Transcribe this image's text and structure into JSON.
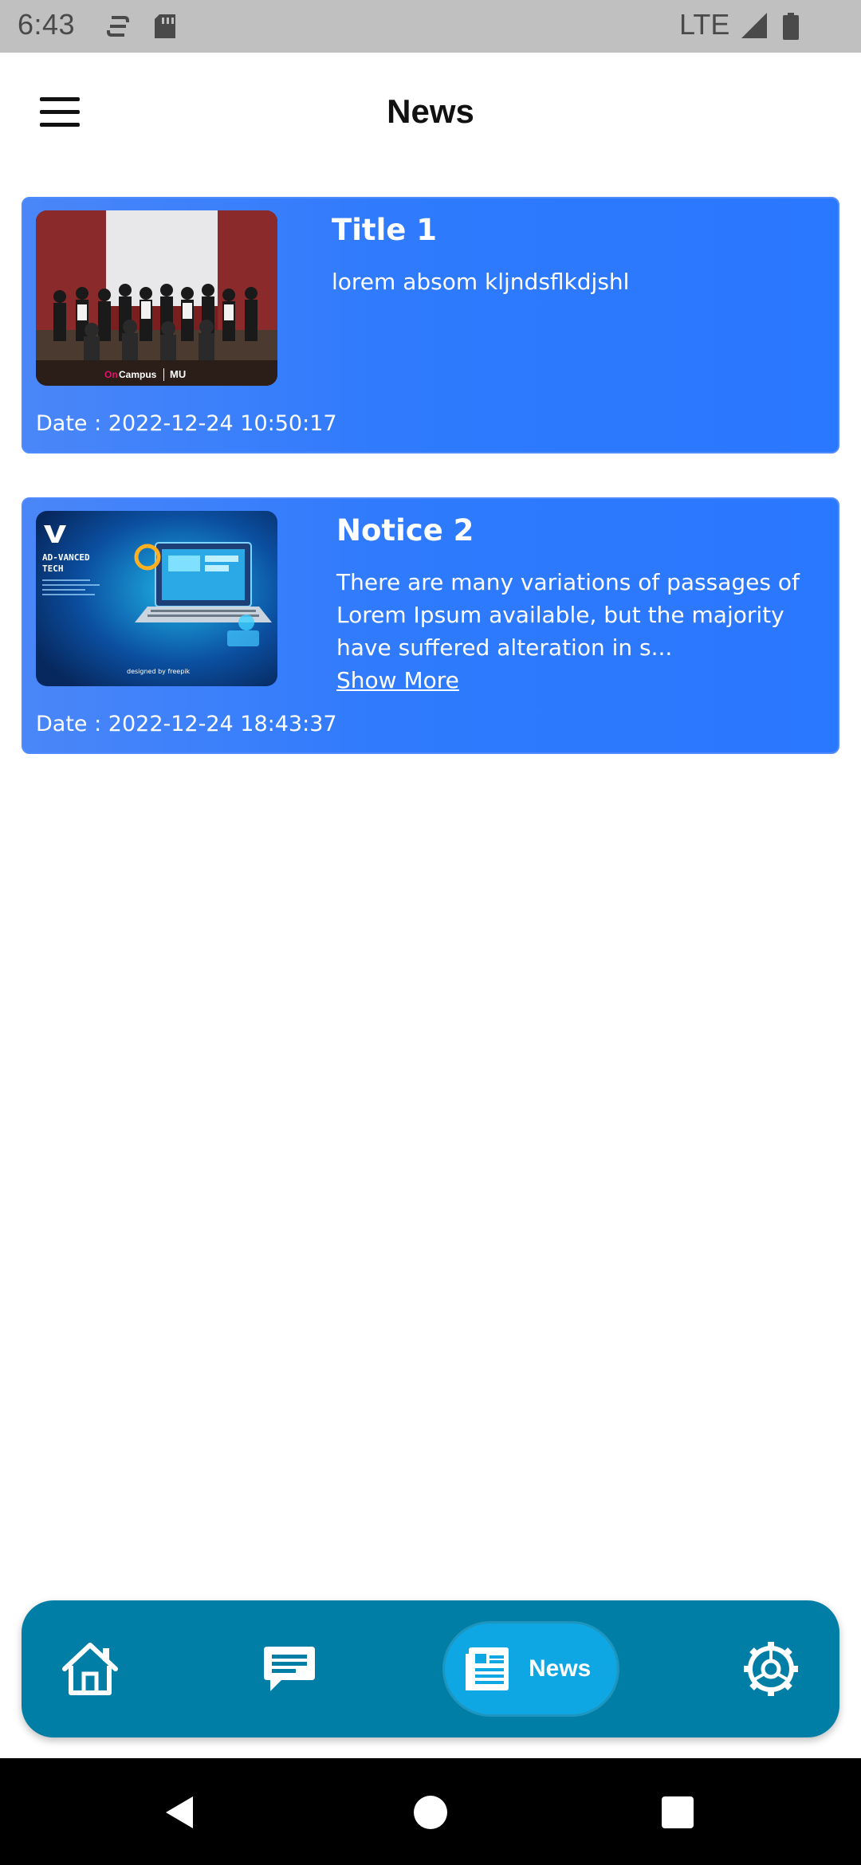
{
  "status_bar": {
    "time": "6:43",
    "network": "LTE",
    "icons": [
      "sync-icon",
      "sd-card-icon",
      "signal-icon",
      "battery-icon"
    ]
  },
  "header": {
    "title": "News",
    "menu_icon": "hamburger-menu-icon"
  },
  "news": [
    {
      "title": "Title 1",
      "body": "lorem absom kljndsflkdjshl",
      "date": "Date : 2022-12-24 10:50:17",
      "thumb": "group-photo",
      "thumb_caption": "OnCampus | MU"
    },
    {
      "title": "Notice 2",
      "body": "There are many variations of passages of Lorem Ipsum available, but the majority have suffered alteration in s...",
      "show_more": "Show More",
      "date": "Date : 2022-12-24 18:43:37",
      "thumb": "advanced-tech-graphic",
      "thumb_caption": "AD-VANCED TECH"
    }
  ],
  "bottom_nav": {
    "items": [
      {
        "icon": "home-icon"
      },
      {
        "icon": "chat-icon"
      },
      {
        "icon": "news-icon",
        "label": "News",
        "active": true
      },
      {
        "icon": "settings-icon"
      }
    ]
  },
  "colors": {
    "card": "#2f7afd",
    "nav_bg": "#007ea6",
    "nav_active": "#0ea7e3",
    "status_bar": "#c0c0c0"
  }
}
